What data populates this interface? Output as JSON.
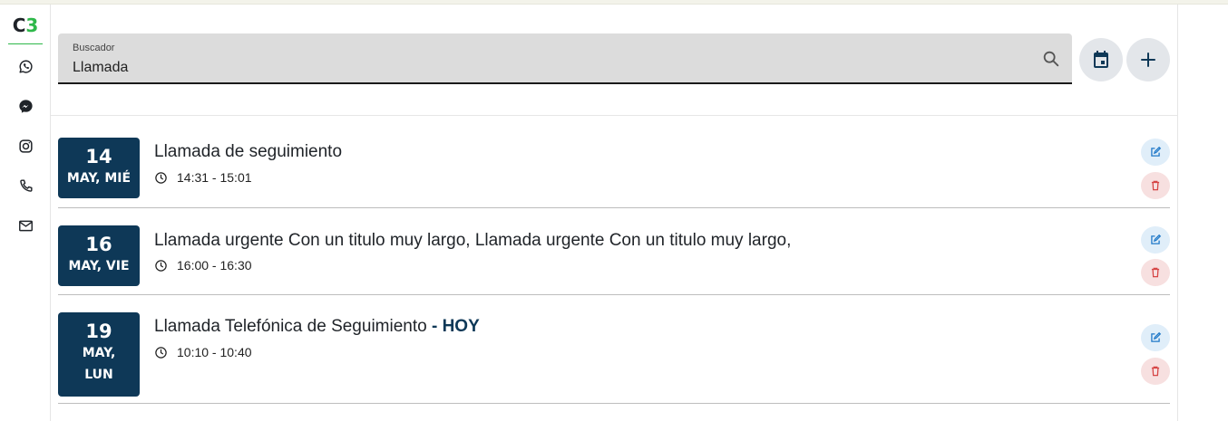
{
  "logo": {
    "letter": "C",
    "number": "3"
  },
  "sidebar": {
    "items": [
      {
        "icon": "whatsapp-icon"
      },
      {
        "icon": "messenger-icon"
      },
      {
        "icon": "instagram-icon"
      },
      {
        "icon": "phone-icon"
      },
      {
        "icon": "mail-icon"
      }
    ]
  },
  "search": {
    "label": "Buscador",
    "value": "Llamada"
  },
  "toolbar": {
    "calendar_icon": "calendar-icon",
    "add_icon": "plus-icon"
  },
  "events": [
    {
      "day": "14",
      "month": "MAY, MIÉ",
      "title": "Llamada de seguimiento",
      "today_badge": "",
      "time": "14:31 - 15:01"
    },
    {
      "day": "16",
      "month": "MAY, VIE",
      "title": "Llamada urgente Con un titulo muy largo, Llamada urgente Con un titulo muy largo,",
      "today_badge": "",
      "time": "16:00 - 16:30"
    },
    {
      "day": "19",
      "month_line1": "MAY,",
      "month_line2": "LUN",
      "title": "Llamada Telefónica de Seguimiento",
      "today_badge": "- HOY",
      "time": "10:10 - 10:40"
    }
  ],
  "colors": {
    "accent_green": "#2eb84a",
    "date_bg": "#0e3857",
    "edit_bg": "#e0eef9",
    "delete_bg": "#f7e0e0",
    "delete_icon": "#d64545",
    "edit_icon": "#1f78c8"
  }
}
